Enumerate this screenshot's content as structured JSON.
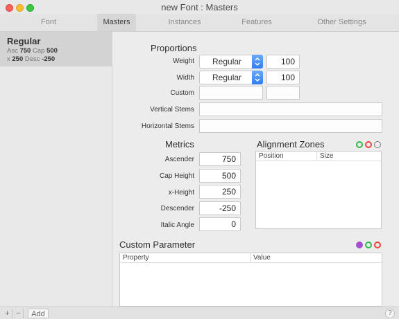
{
  "window": {
    "title": "new Font : Masters"
  },
  "tabs": [
    {
      "label": "Font"
    },
    {
      "label": "Masters"
    },
    {
      "label": "Instances"
    },
    {
      "label": "Features"
    },
    {
      "label": "Other Settings"
    }
  ],
  "sidebar": {
    "master": {
      "name": "Regular",
      "asc_label": "Asc",
      "asc_value": "750",
      "cap_label": "Cap",
      "cap_value": "500",
      "x_label": "x",
      "x_value": "250",
      "desc_label": "Desc",
      "desc_value": "-250"
    }
  },
  "proportions": {
    "title": "Proportions",
    "weight": {
      "label": "Weight",
      "selected": "Regular",
      "value": "100"
    },
    "width": {
      "label": "Width",
      "selected": "Regular",
      "value": "100"
    },
    "custom": {
      "label": "Custom",
      "value": "",
      "number": ""
    }
  },
  "stems": {
    "vertical_label": "Vertical Stems",
    "vertical_value": "",
    "horizontal_label": "Horizontal Stems",
    "horizontal_value": ""
  },
  "metrics": {
    "title": "Metrics",
    "ascender": {
      "label": "Ascender",
      "value": "750"
    },
    "cap_height": {
      "label": "Cap Height",
      "value": "500"
    },
    "x_height": {
      "label": "x-Height",
      "value": "250"
    },
    "descender": {
      "label": "Descender",
      "value": "-250"
    },
    "italic_angle": {
      "label": "Italic Angle",
      "value": "0"
    }
  },
  "alignment_zones": {
    "title": "Alignment Zones",
    "col_position": "Position",
    "col_size": "Size"
  },
  "custom_parameter": {
    "title": "Custom Parameter",
    "col_property": "Property",
    "col_value": "Value"
  },
  "bottombar": {
    "add_label": "+",
    "remove_label": "−",
    "menu_label": "Add",
    "help_label": "?"
  },
  "colors": {
    "accent_blue": "#2f7ff0",
    "add_green": "#31b94a",
    "remove_red": "#e8443a",
    "menu_purple": "#a44fd4"
  }
}
